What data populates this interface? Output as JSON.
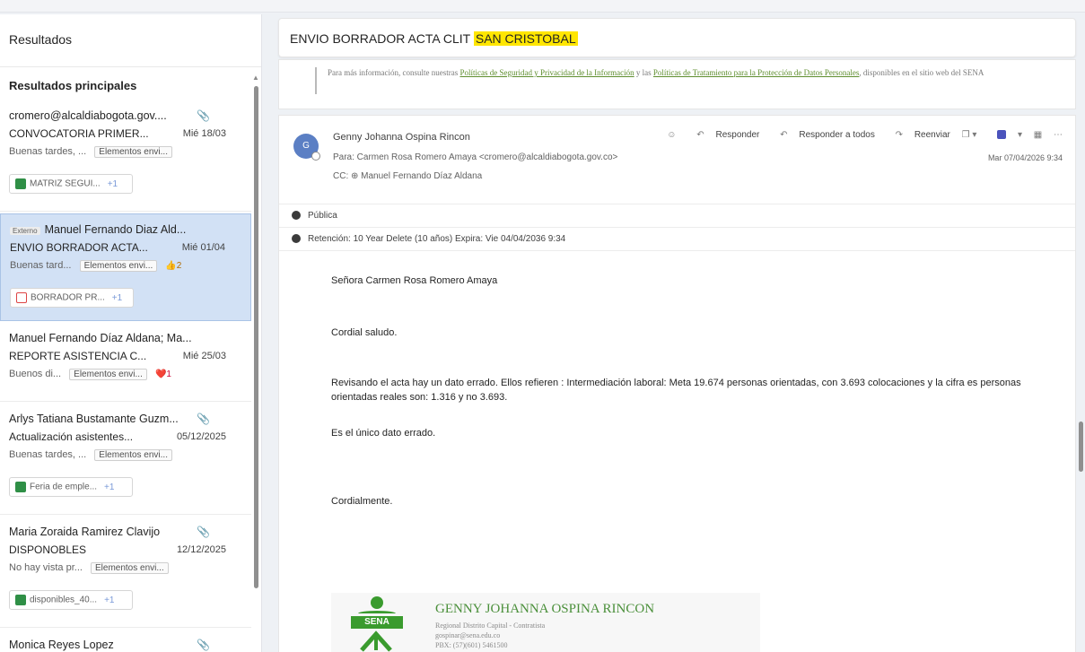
{
  "left_pane": {
    "title": "Resultados",
    "subtitle": "Resultados principales",
    "items": [
      {
        "sender": "cromero@alcaldiabogota.gov....",
        "subject": "CONVOCATORIA PRIMER...",
        "date": "Mié 18/03",
        "preview": "Buenas tardes, ...",
        "folder": "Elementos envi...",
        "attachment": "MATRIZ SEGUI...",
        "attachment_more": "+1",
        "has_clip": true
      },
      {
        "external_tag": "Externo",
        "sender": "Manuel Fernando Diaz Ald...",
        "subject": "ENVIO BORRADOR ACTA...",
        "date": "Mié 01/04",
        "preview": "Buenas tard...",
        "folder": "Elementos envi...",
        "reaction": "👍2",
        "attachment": "BORRADOR PR...",
        "attachment_more": "+1",
        "selected": true
      },
      {
        "sender": "Manuel Fernando Díaz Aldana; Ma...",
        "subject": "REPORTE ASISTENCIA C...",
        "date": "Mié 25/03",
        "preview": "Buenos di...",
        "folder": "Elementos envi...",
        "reaction": "❤️1"
      },
      {
        "sender": "Arlys Tatiana Bustamante Guzm...",
        "subject": "Actualización asistentes...",
        "date": "05/12/2025",
        "preview": "Buenas tardes, ...",
        "folder": "Elementos envi...",
        "attachment": "Feria de emple...",
        "attachment_more": "+1",
        "has_clip": true
      },
      {
        "sender": "Maria Zoraida Ramirez Clavijo",
        "subject": "DISPONOBLES",
        "date": "12/12/2025",
        "preview": "No hay vista pr...",
        "folder": "Elementos envi...",
        "attachment": "disponibles_40...",
        "attachment_more": "+1",
        "has_clip": true
      },
      {
        "sender": "Monica Reyes Lopez",
        "has_clip": true
      }
    ]
  },
  "reading_pane": {
    "subject_prefix": "ENVIO BORRADOR ACTA CLIT ",
    "subject_highlight": "SAN CRISTOBAL",
    "previous_footer": {
      "text_1": "Para más información, consulte nuestras ",
      "link_1": "Políticas de Seguridad y Privacidad de la Información",
      "text_2": " y las ",
      "link_2": "Políticas de Tratamiento para la Protección de Datos Personales",
      "text_3": ", disponibles en el sitio web del SENA"
    },
    "message": {
      "avatar_initials": "G",
      "from": "Genny Johanna Ospina Rincon",
      "to": "Para:  Carmen Rosa Romero Amaya <cromero@alcaldiabogota.gov.co>",
      "cc": "CC:  ⊕ Manuel Fernando Díaz Aldana",
      "date": "Mar 07/04/2026 9:34",
      "actions": {
        "emoji_icon": "☺",
        "reply": "Responder",
        "reply_all": "Responder a todos",
        "forward": "Reenviar"
      },
      "sensitivity": "Pública",
      "retention": "Retención: 10 Year Delete (10 años)  Expira: Vie 04/04/2036 9:34",
      "body": {
        "greeting": "Señora Carmen Rosa Romero Amaya",
        "salutation": "Cordial saludo.",
        "paragraph": "Revisando el acta hay un dato errado.  Ellos refieren : Intermediación laboral: Meta 19.674 personas orientadas, con 3.693 colocaciones y la cifra es personas orientadas reales son: 1.316 y no 3.693.",
        "line_2": "Es el único dato errado.",
        "closing": "Cordialmente."
      },
      "signature": {
        "logo_text": "SENA",
        "name": "GENNY JOHANNA OSPINA RINCON",
        "line_1": "Regional Distrito Capital - Contratista",
        "line_2": "gospinar@sena.edu.co",
        "line_3": "PBX: (57)(601) 5461500"
      }
    }
  },
  "colors": {
    "highlight": "#ffe600",
    "selected_item_bg": "#d2e1f5",
    "sena_green": "#3a9b2e"
  }
}
